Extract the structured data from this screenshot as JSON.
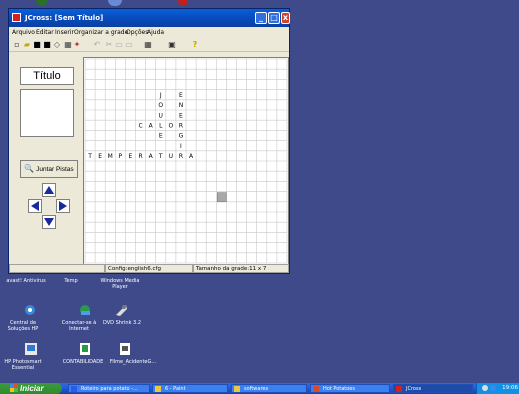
{
  "window": {
    "title": "JCross: [Sem Título]",
    "controls": {
      "minimize": "_",
      "maximize": "□",
      "close": "x"
    }
  },
  "menu": [
    "Arquivo",
    "Editar",
    "Inserir",
    "Organizar a grade",
    "Opções",
    "Ajuda"
  ],
  "toolbar": [
    "new-icon",
    "open-icon",
    "save-icon",
    "save-as-icon",
    "eraser-icon",
    "grid-icon",
    "add-icon",
    "undo-icon",
    "cut-icon",
    "copy-icon",
    "paste-icon",
    "grid-size-icon",
    "export-icon",
    "help-icon"
  ],
  "left_panel": {
    "title": "Título",
    "juntar_label": "Juntar Pistas"
  },
  "grid": {
    "size_cols": 11,
    "size_rows": 7,
    "letters": [
      {
        "text": "J",
        "col": 7,
        "row": 3
      },
      {
        "text": "O",
        "col": 7,
        "row": 4
      },
      {
        "text": "U",
        "col": 7,
        "row": 5
      },
      {
        "text": "L",
        "col": 7,
        "row": 6
      },
      {
        "text": "E",
        "col": 7,
        "row": 7
      },
      {
        "text": "E",
        "col": 9,
        "row": 3
      },
      {
        "text": "N",
        "col": 9,
        "row": 4
      },
      {
        "text": "E",
        "col": 9,
        "row": 5
      },
      {
        "text": "R",
        "col": 9,
        "row": 6
      },
      {
        "text": "G",
        "col": 9,
        "row": 7
      },
      {
        "text": "I",
        "col": 9,
        "row": 8
      },
      {
        "text": "C",
        "col": 5,
        "row": 6
      },
      {
        "text": "A",
        "col": 6,
        "row": 6
      },
      {
        "text": "O",
        "col": 8,
        "row": 6
      },
      {
        "text": "T",
        "col": 0,
        "row": 9
      },
      {
        "text": "E",
        "col": 1,
        "row": 9
      },
      {
        "text": "M",
        "col": 2,
        "row": 9
      },
      {
        "text": "P",
        "col": 3,
        "row": 9
      },
      {
        "text": "E",
        "col": 4,
        "row": 9
      },
      {
        "text": "R",
        "col": 5,
        "row": 9
      },
      {
        "text": "A",
        "col": 6,
        "row": 9
      },
      {
        "text": "T",
        "col": 7,
        "row": 9
      },
      {
        "text": "U",
        "col": 8,
        "row": 9
      },
      {
        "text": "R",
        "col": 9,
        "row": 9
      },
      {
        "text": "A",
        "col": 10,
        "row": 9
      }
    ]
  },
  "status": {
    "config": "Config:english6.cfg",
    "grid_size": "Tamanho da grade:11 x 7"
  },
  "desktop_icons": [
    {
      "label": "avast! Antivirus",
      "icon": "antivirus-icon"
    },
    {
      "label": "Temp",
      "icon": "folder-icon"
    },
    {
      "label": "Windows Media Player",
      "icon": "media-player-icon"
    },
    {
      "label": "Central de Soluções HP",
      "icon": "hp-solutions-icon"
    },
    {
      "label": "Conectar-se à Internet",
      "icon": "internet-icon"
    },
    {
      "label": "DVD Shrink 3.2",
      "icon": "dvd-shrink-icon"
    },
    {
      "label": "HP Photosmart Essential",
      "icon": "photosmart-icon"
    },
    {
      "label": "CONTABILIDADE",
      "icon": "spreadsheet-icon"
    },
    {
      "label": "Filme_AcidenteG...",
      "icon": "movie-file-icon"
    }
  ],
  "taskbar": {
    "start_label": "Iniciar",
    "tasks": [
      "Roteiro para potato -...",
      "6 - Paint",
      "softwares",
      "Hot Potatoes",
      "JCross"
    ],
    "clock": "19:06"
  },
  "colors": {
    "desktop": "#3f4a8a",
    "titlebar": "#0a5fd8",
    "taskbar": "#245edb",
    "start": "#2f8a2f"
  }
}
